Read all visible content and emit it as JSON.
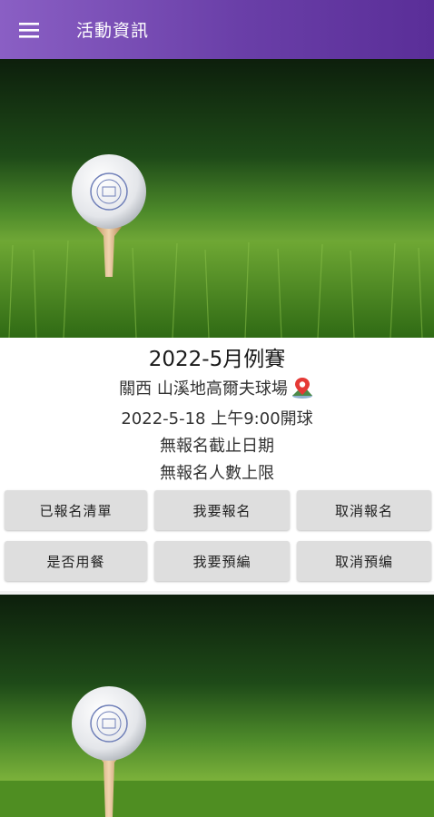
{
  "app_bar": {
    "title": "活動資訊",
    "menu_icon": "hamburger-menu-icon",
    "gradient_start": "#8a5fc4",
    "gradient_end": "#5a2e98"
  },
  "event": {
    "title": "2022-5月例賽",
    "location": "關西 山溪地高爾夫球場",
    "location_icon": "map-pin-icon",
    "datetime": "2022-5-18 上午9:00開球",
    "registration_deadline": "無報名截止日期",
    "registration_limit": "無報名人數上限"
  },
  "actions": {
    "registered_list": "已報名清單",
    "register": "我要報名",
    "cancel_registration": "取消報名",
    "meal_option": "是否用餐",
    "pre_book": "我要預編",
    "cancel_pre_book": "取消預编"
  }
}
